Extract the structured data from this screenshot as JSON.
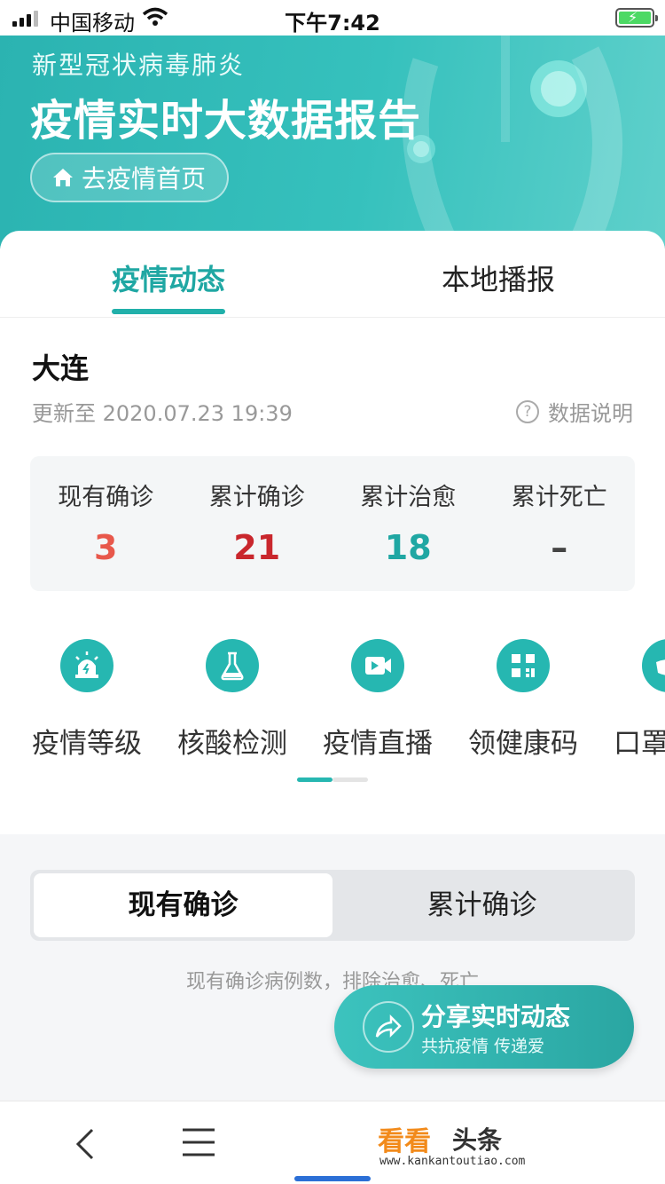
{
  "status_bar": {
    "carrier": "中国移动",
    "time": "下午7:42"
  },
  "banner": {
    "subtitle": "新型冠状病毒肺炎",
    "title": "疫情实时大数据报告",
    "home_button_label": "去疫情首页"
  },
  "tabs": [
    {
      "label": "疫情动态",
      "active": true
    },
    {
      "label": "本地播报",
      "active": false
    }
  ],
  "location": {
    "city": "大连",
    "updated": "更新至 2020.07.23 19:39",
    "help_label": "数据说明"
  },
  "stats": [
    {
      "label": "现有确诊",
      "value": "3",
      "color": "#e8584b"
    },
    {
      "label": "累计确诊",
      "value": "21",
      "color": "#c9272d"
    },
    {
      "label": "累计治愈",
      "value": "18",
      "color": "#1fa7a3"
    },
    {
      "label": "累计死亡",
      "value": "–",
      "color": "#444444"
    }
  ],
  "services": [
    {
      "label": "疫情等级",
      "icon": "alarm-icon"
    },
    {
      "label": "核酸检测",
      "icon": "flask-icon"
    },
    {
      "label": "疫情直播",
      "icon": "video-icon"
    },
    {
      "label": "领健康码",
      "icon": "qr-code-icon"
    },
    {
      "label": "口罩",
      "icon": "mask-icon"
    }
  ],
  "segment": {
    "active": "现有确诊",
    "inactive": "累计确诊"
  },
  "note": "现有确诊病例数，排除治愈、死亡",
  "share": {
    "title": "分享实时动态",
    "subtitle": "共抗疫情 传递爱"
  },
  "brand": {
    "name_colored": "看看",
    "name_dark": "头条",
    "url": "www.kankantoutiao.com"
  },
  "colors": {
    "accent": "#26b7b1",
    "banner": "#2bb3b1"
  }
}
